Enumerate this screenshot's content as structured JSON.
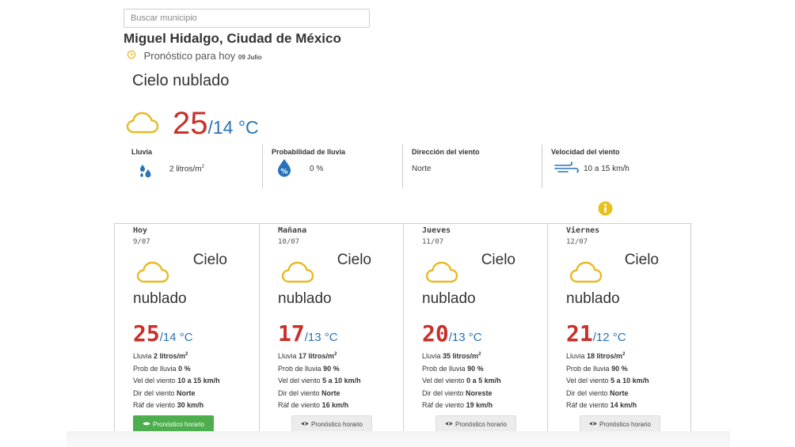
{
  "search": {
    "placeholder": "Buscar municipio"
  },
  "location": {
    "title": "Miguel Hidalgo, Ciudad de México"
  },
  "today": {
    "forecast_label": "Pronóstico para hoy",
    "date": "09 Julio",
    "condition": "Cielo nublado",
    "temp_max": "25",
    "temp_min": "/14 °C",
    "icon": "cloud-icon"
  },
  "stats": {
    "rain": {
      "label": "Lluvia",
      "value": "2 litros/m",
      "sup": "2",
      "icon": "raindrops-icon"
    },
    "rain_prob": {
      "label": "Probabilidad de lluvia",
      "value": "0 %",
      "icon": "percent-drop-icon"
    },
    "wind_dir": {
      "label": "Dirección del viento",
      "value": "Norte"
    },
    "wind_speed": {
      "label": "Velocidad del viento",
      "value": "10 a 15 km/h",
      "icon": "wind-icon"
    }
  },
  "labels": {
    "rain": "Lluvia",
    "prob": "Prob de lluvia",
    "wind_vel": "Vel del viento",
    "wind_dir": "Dir del viento",
    "gust": "Ráf de viento",
    "hourly_button": "Pronóstico horario",
    "sup2": "2"
  },
  "days": [
    {
      "name": "Hoy",
      "date": "9/07",
      "cond1": "Cielo",
      "cond2": "nublado",
      "max": "25",
      "min": "/14 °C",
      "rain": "2 litros/m",
      "prob": "0 %",
      "wind": "10 a 15 km/h",
      "dir": "Norte",
      "gust": "30 km/h",
      "active": true
    },
    {
      "name": "Mañana",
      "date": "10/07",
      "cond1": "Cielo",
      "cond2": "nublado",
      "max": "17",
      "min": "/13 °C",
      "rain": "17 litros/m",
      "prob": "90 %",
      "wind": "5 a 10 km/h",
      "dir": "Norte",
      "gust": "16 km/h",
      "active": false
    },
    {
      "name": "Jueves",
      "date": "11/07",
      "cond1": "Cielo",
      "cond2": "nublado",
      "max": "20",
      "min": "/13 °C",
      "rain": "35 litros/m",
      "prob": "90 %",
      "wind": "0 a 5 km/h",
      "dir": "Noreste",
      "gust": "19 km/h",
      "active": false
    },
    {
      "name": "Viernes",
      "date": "12/07",
      "cond1": "Cielo",
      "cond2": "nublado",
      "max": "21",
      "min": "/12 °C",
      "rain": "18 litros/m",
      "prob": "90 %",
      "wind": "5 a 10 km/h",
      "dir": "Norte",
      "gust": "14 km/h",
      "active": false
    }
  ],
  "colors": {
    "max_temp": "#c8302a",
    "min_temp": "#2673b8",
    "cloud": "#e8b923",
    "active_button": "#4cae4c",
    "info": "#e8c21b"
  }
}
